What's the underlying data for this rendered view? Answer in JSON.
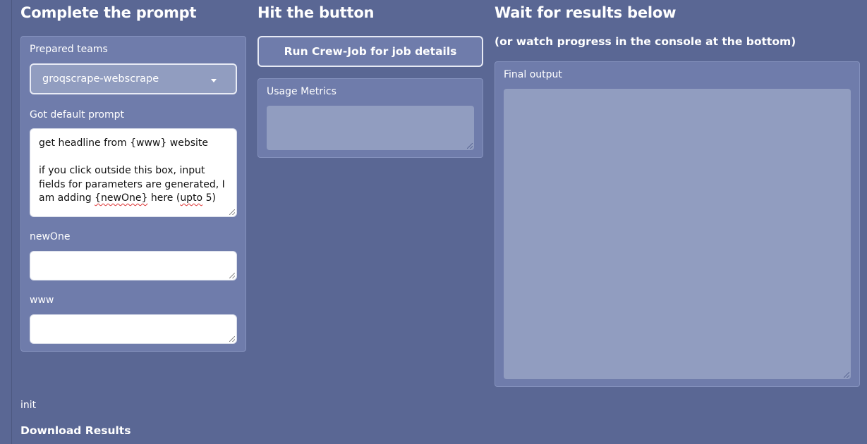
{
  "columns": {
    "left": {
      "title": "Complete the prompt"
    },
    "middle": {
      "title": "Hit the button"
    },
    "right": {
      "title": "Wait for results below",
      "subtitle": "(or watch progress in the console at the bottom)"
    }
  },
  "teams": {
    "label": "Prepared teams",
    "selected": "groqscrape-webscrape"
  },
  "prompt": {
    "label": "Got default prompt",
    "line1": "get headline from {www} website",
    "line2_before": "if you click outside this box, input fields for parameters are generated, I am adding ",
    "line2_word1": "{newOne}",
    "line2_middle": " here (",
    "line2_word2": "upto",
    "line2_after": " 5)"
  },
  "params": [
    {
      "label": "newOne",
      "value": ""
    },
    {
      "label": "www",
      "value": ""
    }
  ],
  "run_button": {
    "label": "Run Crew-Job for job details"
  },
  "usage_metrics": {
    "label": "Usage Metrics",
    "value": ""
  },
  "final_output": {
    "label": "Final output",
    "value": ""
  },
  "status": {
    "text": "init"
  },
  "download": {
    "label": "Download Results"
  },
  "colors": {
    "background": "#5a6794",
    "panel": "#6f7cab",
    "field_fill": "#919dc0",
    "text": "#ffffff"
  },
  "icons": {
    "dropdown": "chevron-down-icon",
    "resize": "resize-grip-icon"
  }
}
